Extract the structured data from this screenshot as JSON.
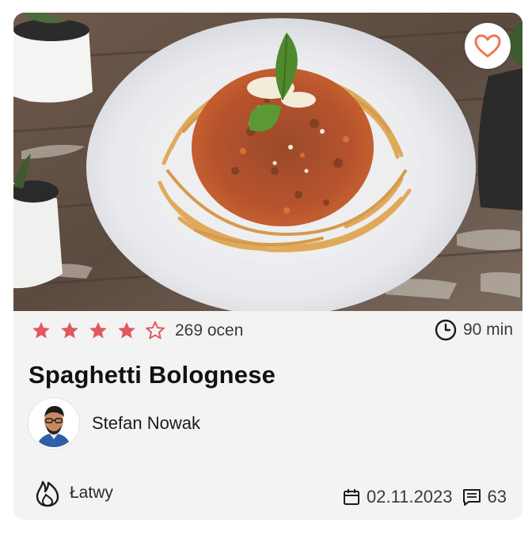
{
  "recipe": {
    "title": "Spaghetti Bolognese",
    "rating": 4,
    "max_rating": 5,
    "rating_count_label": "269 ocen",
    "time_label": "90 min",
    "author_name": "Stefan Nowak",
    "difficulty_label": "Łatwy",
    "date_label": "02.11.2023",
    "comments_label": "63"
  },
  "icons": {
    "favorite": "heart-outline-icon",
    "time": "clock-icon",
    "difficulty": "flame-icon",
    "date": "calendar-icon",
    "comments": "comment-icon"
  },
  "colors": {
    "star": "#e0585e",
    "heart": "#f0754c",
    "card_bg": "#f3f3f3"
  }
}
